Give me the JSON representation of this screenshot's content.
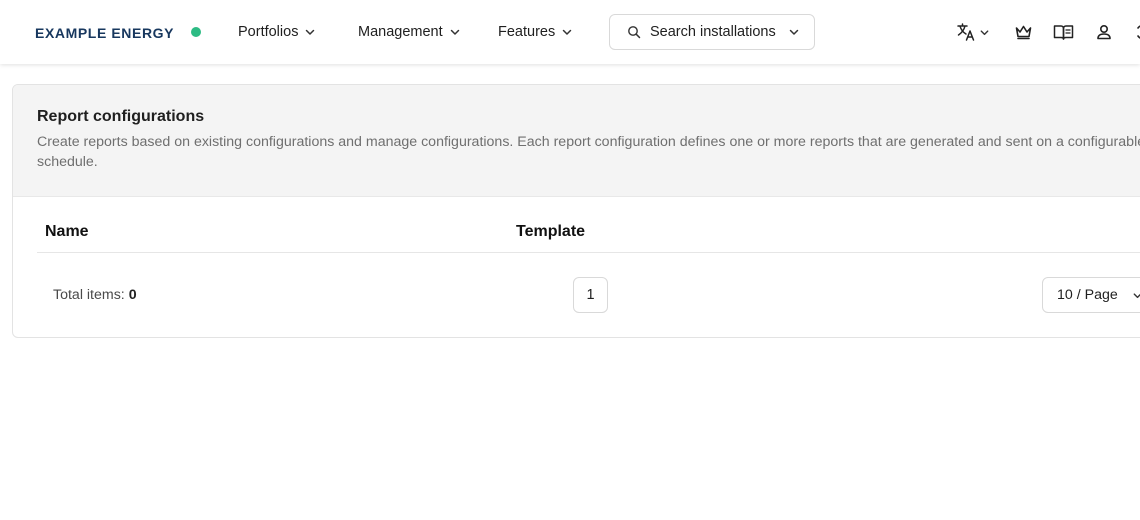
{
  "header": {
    "brand": "EXAMPLE ENERGY",
    "status_color": "#2dbb84",
    "nav": [
      {
        "label": "Portfolios"
      },
      {
        "label": "Management"
      },
      {
        "label": "Features"
      }
    ],
    "search": {
      "placeholder": "Search installations"
    },
    "icons": [
      "translate-icon",
      "crown-icon",
      "book-icon",
      "user-icon",
      "settings-icon"
    ]
  },
  "page": {
    "title": "Report configurations",
    "description": "Create reports based on existing configurations and manage configurations. Each report configuration defines one or more reports that are generated and sent on a configurable schedule."
  },
  "table": {
    "columns": [
      "Name",
      "Template"
    ],
    "rows": []
  },
  "pagination": {
    "total_label": "Total items:",
    "total_value": "0",
    "current_page": "1",
    "page_size": "10 / Page"
  }
}
